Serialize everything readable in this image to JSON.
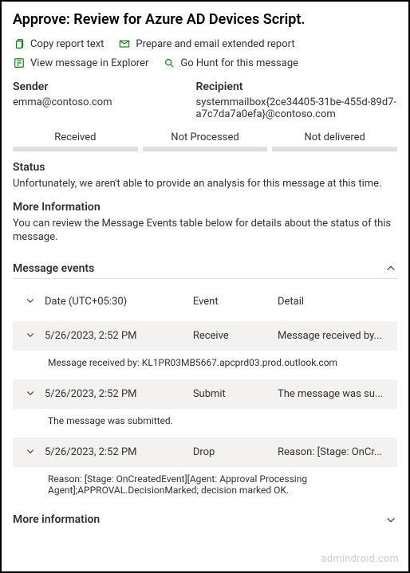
{
  "title": "Approve: Review for Azure AD Devices Script.",
  "actions": {
    "copy_report": "Copy report text",
    "prepare_email": "Prepare and email extended report",
    "view_explorer": "View message in Explorer",
    "go_hunt": "Go Hunt for this message"
  },
  "sender": {
    "label": "Sender",
    "value": "emma@contoso.com"
  },
  "recipient": {
    "label": "Recipient",
    "value": "systemmailbox{2ce34405-31be-455d-89d7-a7c7da7a0efa}@contoso.com"
  },
  "progress": {
    "received": "Received",
    "not_processed": "Not Processed",
    "not_delivered": "Not delivered"
  },
  "status": {
    "label": "Status",
    "body": "Unfortunately, we aren't able to provide an analysis for this message at this time."
  },
  "more_info": {
    "label": "More Information",
    "body": "You can review the Message Events table below for details about the status of this message."
  },
  "events_section": {
    "title": "Message events",
    "headers": {
      "date": "Date (UTC+05:30)",
      "event": "Event",
      "detail": "Detail"
    },
    "rows": [
      {
        "date": "5/26/2023, 2:52 PM",
        "event": "Receive",
        "detail_short": "Message received by...",
        "detail_full": "Message received by: KL1PR03MB5667.apcprd03.prod.outlook.com"
      },
      {
        "date": "5/26/2023, 2:52 PM",
        "event": "Submit",
        "detail_short": "The message was su...",
        "detail_full": "The message was submitted."
      },
      {
        "date": "5/26/2023, 2:52 PM",
        "event": "Drop",
        "detail_short": "Reason: [Stage: OnCr...",
        "detail_full": "Reason: [Stage: OnCreatedEvent][Agent: Approval Processing Agent];APPROVAL.DecisionMarked; decision marked OK."
      }
    ]
  },
  "bottom_more": "More information",
  "watermark": "admindroid.com"
}
